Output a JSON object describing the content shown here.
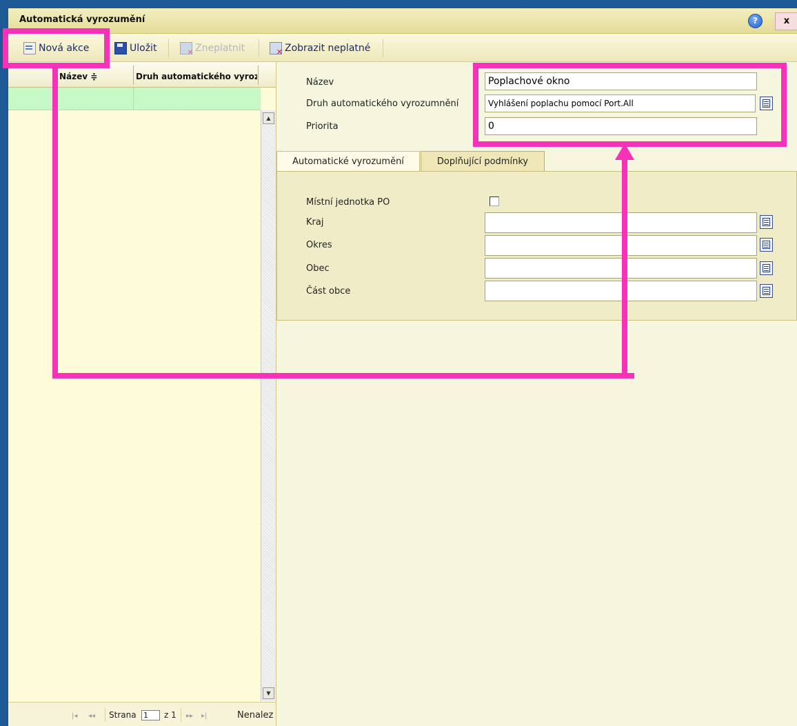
{
  "window": {
    "title": "Automatická vyrozumění",
    "help_label": "?",
    "close_label": "x"
  },
  "toolbar": {
    "new_action": "Nová akce",
    "save": "Uložit",
    "invalidate": "Zneplatnit",
    "show_invalid": "Zobrazit neplatné"
  },
  "grid": {
    "columns": [
      "Název",
      "Druh automatického vyrozu"
    ],
    "sort_indicator": "≑"
  },
  "pager": {
    "first": "|◂",
    "prev": "◂◂",
    "page_label": "Strana",
    "page_value": "1",
    "of_label": "z 1",
    "next": "▸▸",
    "last": "▸|",
    "not_found": "Nenalez"
  },
  "form": {
    "name_label": "Název",
    "name_value": "Poplachové okno",
    "kind_label": "Druh automatického vyrozumnění",
    "kind_value": "Vyhlášení poplachu pomocí Port.All",
    "priority_label": "Priorita",
    "priority_value": "0"
  },
  "tabs": [
    {
      "label": "Automatické vyrozumění",
      "active": true
    },
    {
      "label": "Doplňující podmínky",
      "active": false
    }
  ],
  "tab_panel": {
    "local_unit_label": "Místní jednotka PO",
    "local_unit_checked": false,
    "region_label": "Kraj",
    "region_value": "",
    "district_label": "Okres",
    "district_value": "",
    "municipality_label": "Obec",
    "municipality_value": "",
    "part_label": "Část obce",
    "part_value": ""
  },
  "annotation_color": "#f632b8"
}
